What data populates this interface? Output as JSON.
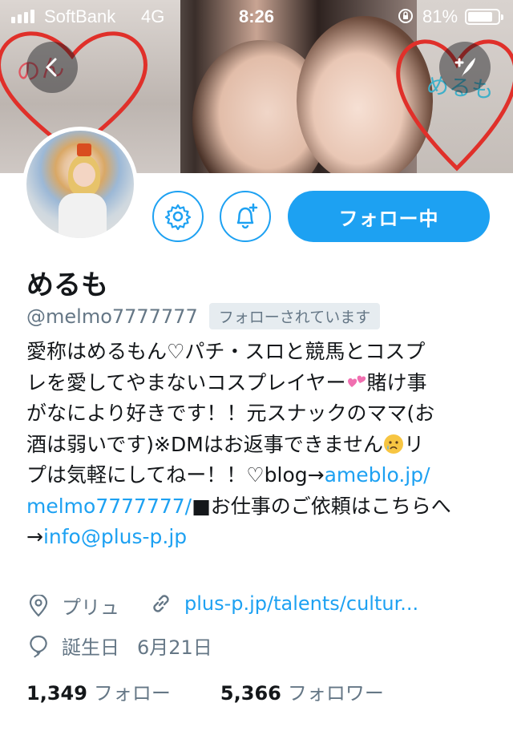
{
  "status_bar": {
    "carrier": "SoftBank",
    "network": "4G",
    "time": "8:26",
    "battery": "81%"
  },
  "profile": {
    "name": "めるも",
    "handle": "@melmo7777777",
    "follows_you": "フォローされています",
    "follow_button": "フォロー中",
    "bio": {
      "line1": "愛称はめるもん♡パチ・スロと競馬とコスプ",
      "line2a": "レを愛してやまないコスプレイヤー",
      "line2b": "賭け事",
      "line3": "がなにより好きです！！元スナックのママ(お",
      "line4a": "酒は弱いです)※DMはお返事できません",
      "line4b": "リ",
      "line5a": "プは気軽にしてねー！！♡blog→",
      "line5link": "ameblo.jp/",
      "line6link": "melmo7777777/",
      "line6b": "■お仕事のご依頼はこちらへ",
      "line7a": "→",
      "line7link": "info@plus-p.jp"
    },
    "location": "プリュ",
    "url": "plus-p.jp/talents/cultur...",
    "birthday_label": "誕生日",
    "birthday": "6月21日",
    "following_count": "1,349",
    "following_label": "フォロー",
    "followers_count": "5,366",
    "followers_label": "フォロワー"
  },
  "banner": {
    "handwriting_left": "のん",
    "handwriting_right": "めるも"
  },
  "icons": {
    "back": "chevron-left-icon",
    "compose": "compose-tweet-icon",
    "settings": "gear-icon",
    "notify": "bell-plus-icon",
    "location": "location-pin-icon",
    "link": "link-icon",
    "birthday": "balloon-icon"
  },
  "colors": {
    "accent": "#1da1f2",
    "secondary_text": "#657786",
    "badge_bg": "#e6ecf0",
    "heart": "#e0302a"
  }
}
